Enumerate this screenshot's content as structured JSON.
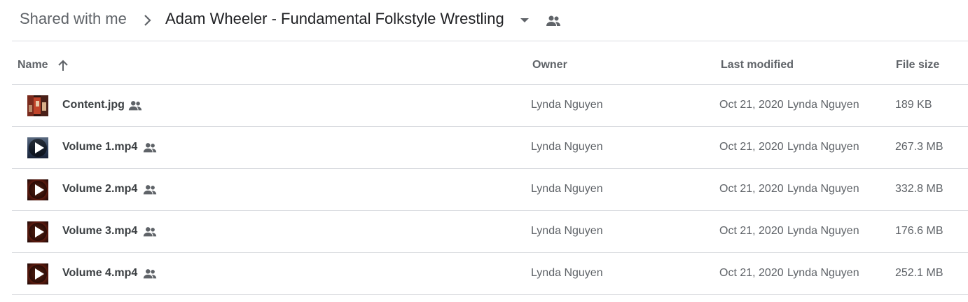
{
  "breadcrumb": {
    "root": "Shared with me",
    "current": "Adam Wheeler - Fundamental Folkstyle Wrestling",
    "separator_icon": "chevron-right-icon",
    "caret_icon": "arrow-drop-down-icon",
    "shared_icon": "people-icon"
  },
  "columns": {
    "name": "Name",
    "sort_icon": "arrow-upward-icon",
    "owner": "Owner",
    "last_modified": "Last modified",
    "file_size": "File size"
  },
  "files": [
    {
      "name": "Content.jpg",
      "kind": "image",
      "owner": "Lynda Nguyen",
      "modified_date": "Oct 21, 2020",
      "modified_by": "Lynda Nguyen",
      "size": "189 KB",
      "shared_icon": "people-icon"
    },
    {
      "name": "Volume 1.mp4",
      "kind": "video",
      "owner": "Lynda Nguyen",
      "modified_date": "Oct 21, 2020",
      "modified_by": "Lynda Nguyen",
      "size": "267.3 MB",
      "shared_icon": "people-icon"
    },
    {
      "name": "Volume 2.mp4",
      "kind": "video",
      "owner": "Lynda Nguyen",
      "modified_date": "Oct 21, 2020",
      "modified_by": "Lynda Nguyen",
      "size": "332.8 MB",
      "shared_icon": "people-icon"
    },
    {
      "name": "Volume 3.mp4",
      "kind": "video",
      "owner": "Lynda Nguyen",
      "modified_date": "Oct 21, 2020",
      "modified_by": "Lynda Nguyen",
      "size": "176.6 MB",
      "shared_icon": "people-icon"
    },
    {
      "name": "Volume 4.mp4",
      "kind": "video",
      "owner": "Lynda Nguyen",
      "modified_date": "Oct 21, 2020",
      "modified_by": "Lynda Nguyen",
      "size": "252.1 MB",
      "shared_icon": "people-icon"
    }
  ],
  "colors": {
    "text_primary": "#202124",
    "text_secondary": "#5f6368",
    "divider": "#dadce0",
    "icon": "#5f6368"
  }
}
